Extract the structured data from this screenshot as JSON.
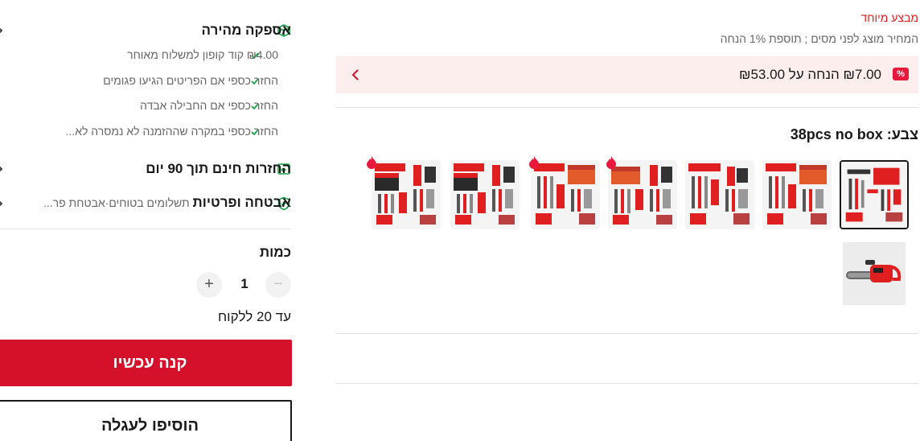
{
  "pricing": {
    "promo_label": "מבצע מיוחד",
    "price_note": "המחיר מוצג לפני מסים ; תוספת 1% הנחה"
  },
  "coupon": {
    "badge": "%",
    "text": "₪7.00 הנחה על ₪53.00"
  },
  "color": {
    "label": "צבע: 38pcs no box"
  },
  "features": {
    "shipping": {
      "title": "אספקה מהירה",
      "bullets": [
        "₪4.00 קוד קופון למשלוח מאוחר",
        "החזר כספי אם הפריטים הגיעו פגומים",
        "החזר כספי אם החבילה אבדה",
        "החזר כספי במקרה שההזמנה לא נמסרה לא..."
      ]
    },
    "returns": {
      "title": "החזרות חינם תוך 90 יום"
    },
    "security": {
      "title": "אבטחה ופרטיות",
      "detail": "תשלומים בטוחים·אבטחת פר..."
    }
  },
  "quantity": {
    "label": "כמות",
    "value": "1",
    "minus": "−",
    "plus": "+",
    "limit": "עד 20 ללקוח"
  },
  "actions": {
    "buy_now": "קנה עכשיו",
    "add_to_cart": "הוסיפו לעגלה"
  },
  "colors": {
    "accent": "#d4102b",
    "coupon_bg": "#fdeeee",
    "check_green": "#1aa34a",
    "promo_red": "#e02020"
  },
  "icons": {
    "shipping": "box-icon",
    "returns": "return-box-icon",
    "security": "shield-check-icon",
    "check": "check-icon",
    "hot": "flame-icon",
    "chevron": "chevron-left-icon"
  }
}
